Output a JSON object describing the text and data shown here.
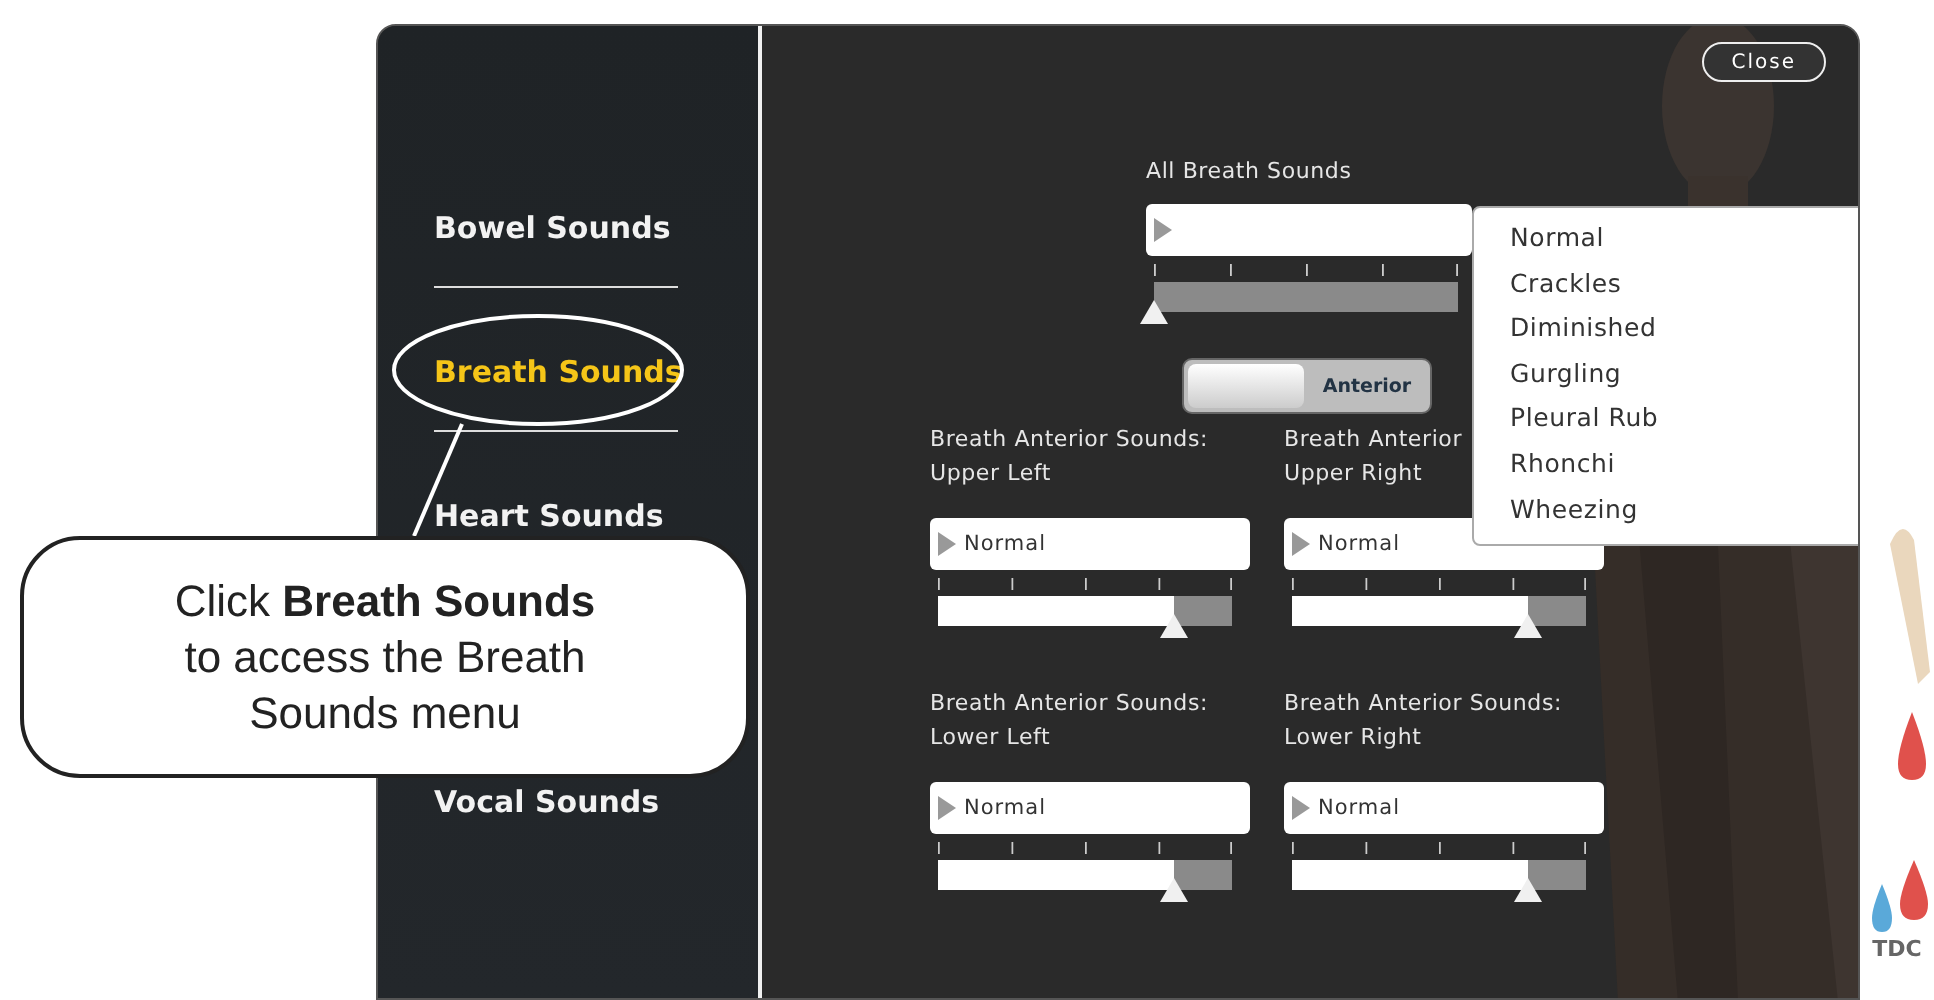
{
  "sidebar": {
    "items": [
      {
        "label": "Bowel Sounds",
        "selected": false
      },
      {
        "label": "Breath Sounds",
        "selected": true
      },
      {
        "label": "Heart Sounds",
        "selected": false
      },
      {
        "label": "Vocal Sounds",
        "selected": false
      }
    ]
  },
  "close_button": "Close",
  "all_breath_sounds": {
    "label": "All Breath Sounds",
    "level": 0,
    "toggle": "Anterior",
    "toggle_on": true
  },
  "dropdown_menu": {
    "options": [
      "Normal",
      "Crackles",
      "Diminished",
      "Gurgling",
      "Pleural Rub",
      "Rhonchi",
      "Wheezing"
    ]
  },
  "zones": [
    {
      "label": [
        "Breath Anterior Sounds:",
        "Upper Left"
      ],
      "value": "Normal",
      "level": 0.8
    },
    {
      "label": [
        "Breath Anterior",
        "Upper Right"
      ],
      "value": "Normal",
      "level": 0.8
    },
    {
      "label": [
        "Breath Anterior Sounds:",
        "Lower Left"
      ],
      "value": "Normal",
      "level": 0.8
    },
    {
      "label": [
        "Breath Anterior Sounds:",
        "Lower Right"
      ],
      "value": "Normal",
      "level": 0.8
    }
  ],
  "callout": {
    "text": "Click **Breath Sounds** to access the Breath Sounds menu"
  },
  "logo": "TDC"
}
